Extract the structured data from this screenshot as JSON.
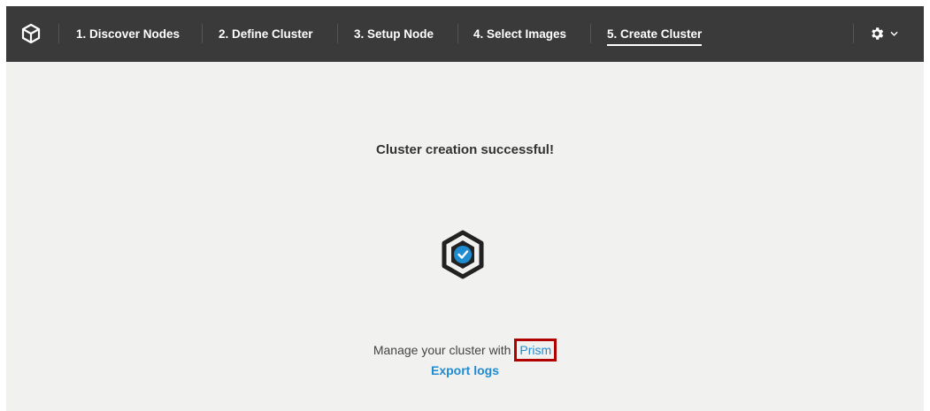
{
  "topbar": {
    "logo_icon": "nutanix-foundation-cube-icon",
    "steps": [
      {
        "label": "1. Discover Nodes",
        "active": false
      },
      {
        "label": "2. Define Cluster",
        "active": false
      },
      {
        "label": "3. Setup Node",
        "active": false
      },
      {
        "label": "4. Select Images",
        "active": false
      },
      {
        "label": "5. Create Cluster",
        "active": true
      }
    ],
    "settings_icon": "gear-icon",
    "dropdown_icon": "chevron-down-icon"
  },
  "main": {
    "title": "Cluster creation successful!",
    "status_icon": "hexagon-check-icon",
    "manage_text": "Manage your cluster with",
    "prism_link": "Prism",
    "export_logs": "Export logs"
  },
  "colors": {
    "topbar_bg": "#3a3a3a",
    "page_bg": "#f1f1ef",
    "link": "#1f8bd1",
    "highlight_box": "#b00000"
  }
}
